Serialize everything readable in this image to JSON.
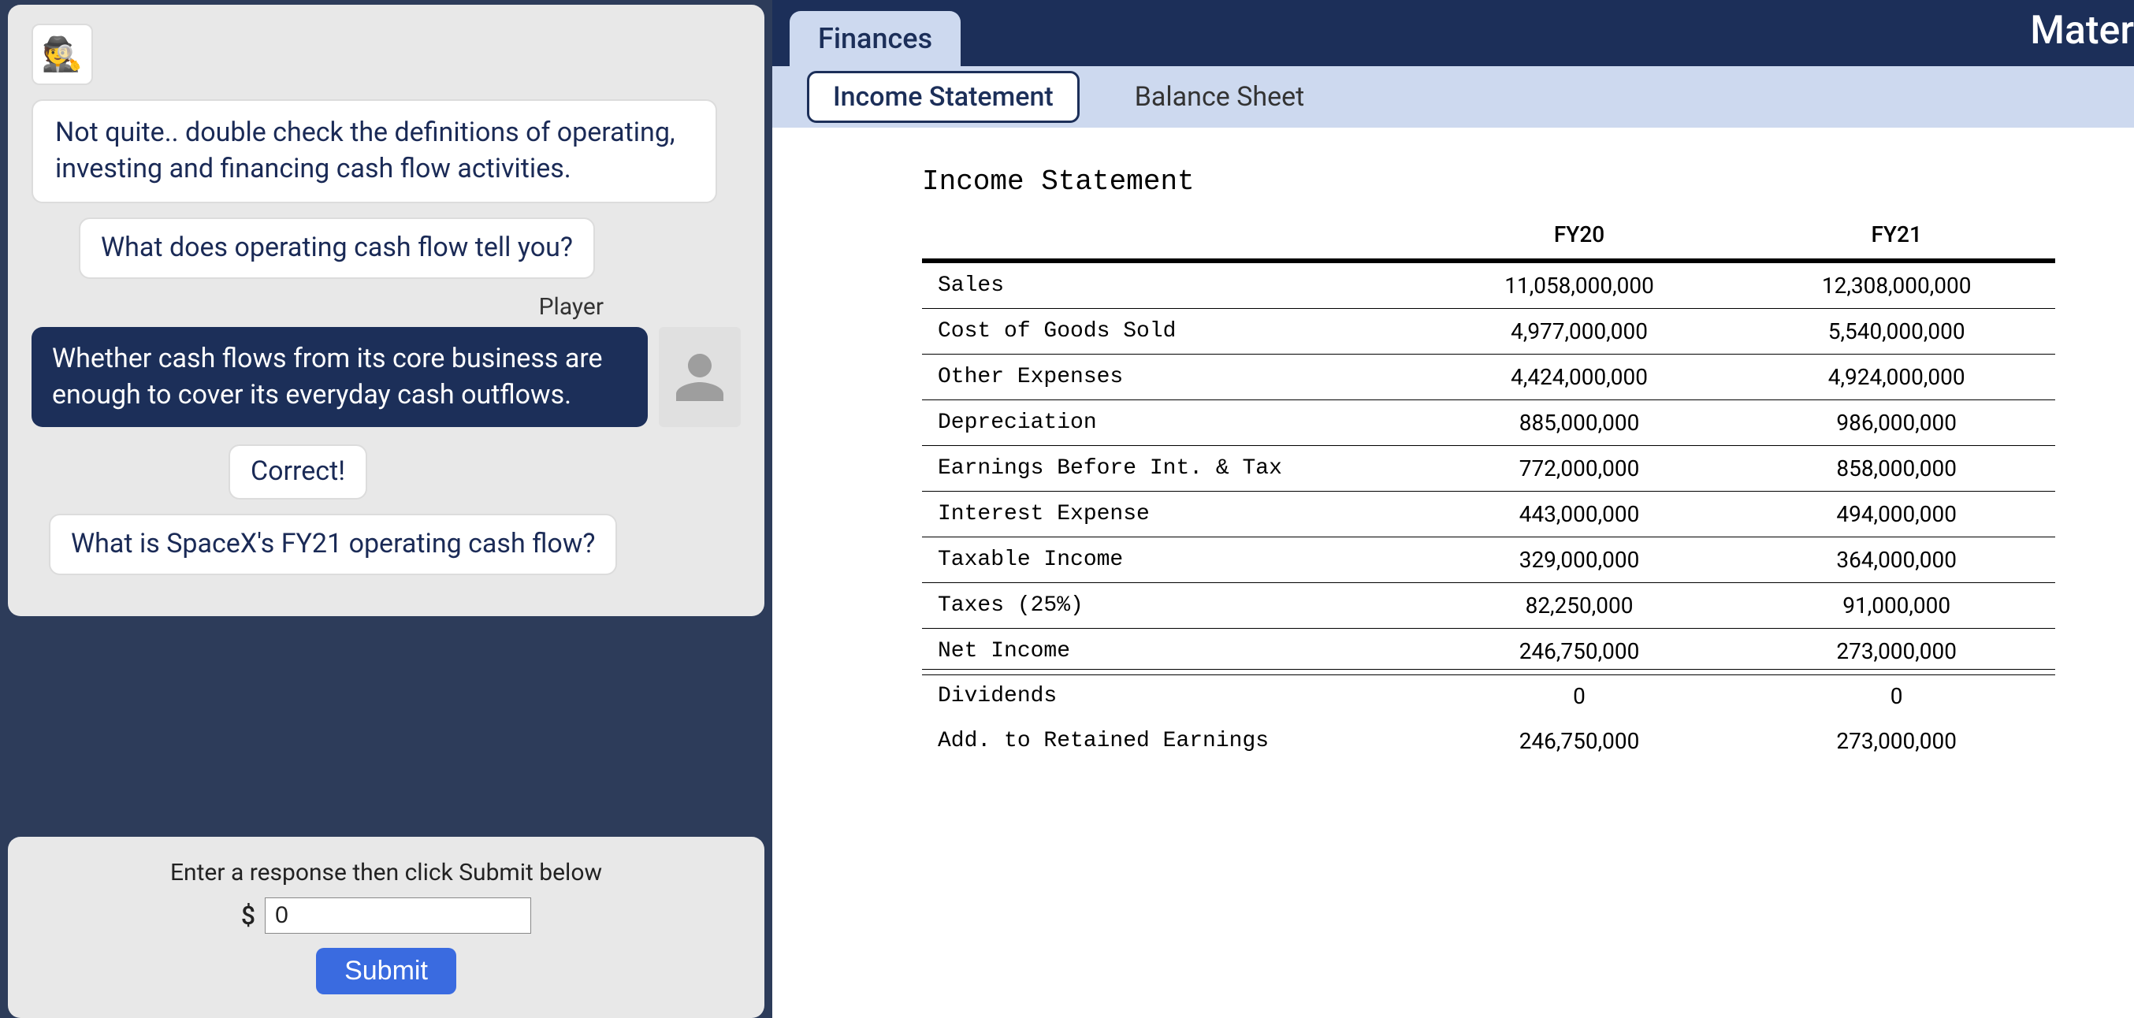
{
  "chat": {
    "npc_avatar_glyph": "🕵️",
    "player_label": "Player",
    "messages": {
      "m1": "Not quite.. double check the definitions of operating, investing and financing cash flow activities.",
      "m2": "What does operating cash flow tell you?",
      "m3": "Whether cash flows from its core business are enough to cover its everyday cash outflows.",
      "m4": "Correct!",
      "m5": "What is SpaceX's FY21 operating cash flow?"
    }
  },
  "input": {
    "prompt": "Enter a response then click Submit below",
    "currency_symbol": "$",
    "value": "0",
    "submit_label": "Submit"
  },
  "app_title": "Mater",
  "tabs": {
    "main": "Finances",
    "sub": {
      "income": "Income Statement",
      "balance": "Balance Sheet"
    }
  },
  "statement": {
    "title": "Income Statement",
    "columns": {
      "c0": "",
      "c1": "FY20",
      "c2": "FY21"
    },
    "rows": [
      {
        "label": "Sales",
        "fy20": "11,058,000,000",
        "fy21": "12,308,000,000",
        "style": "line"
      },
      {
        "label": "Cost of Goods Sold",
        "fy20": "4,977,000,000",
        "fy21": "5,540,000,000",
        "style": "line"
      },
      {
        "label": "Other Expenses",
        "fy20": "4,424,000,000",
        "fy21": "4,924,000,000",
        "style": "line"
      },
      {
        "label": "Depreciation",
        "fy20": "885,000,000",
        "fy21": "986,000,000",
        "style": "line"
      },
      {
        "label": "Earnings Before Int. & Tax",
        "fy20": "772,000,000",
        "fy21": "858,000,000",
        "style": "line"
      },
      {
        "label": "Interest Expense",
        "fy20": "443,000,000",
        "fy21": "494,000,000",
        "style": "line"
      },
      {
        "label": "Taxable Income",
        "fy20": "329,000,000",
        "fy21": "364,000,000",
        "style": "line"
      },
      {
        "label": "Taxes (25%)",
        "fy20": "82,250,000",
        "fy21": "91,000,000",
        "style": "line"
      },
      {
        "label": "Net Income",
        "fy20": "246,750,000",
        "fy21": "273,000,000",
        "style": "double"
      },
      {
        "label": "Dividends",
        "fy20": "0",
        "fy21": "0",
        "style": "none"
      },
      {
        "label": "Add. to Retained Earnings",
        "fy20": "246,750,000",
        "fy21": "273,000,000",
        "style": "none"
      }
    ]
  }
}
